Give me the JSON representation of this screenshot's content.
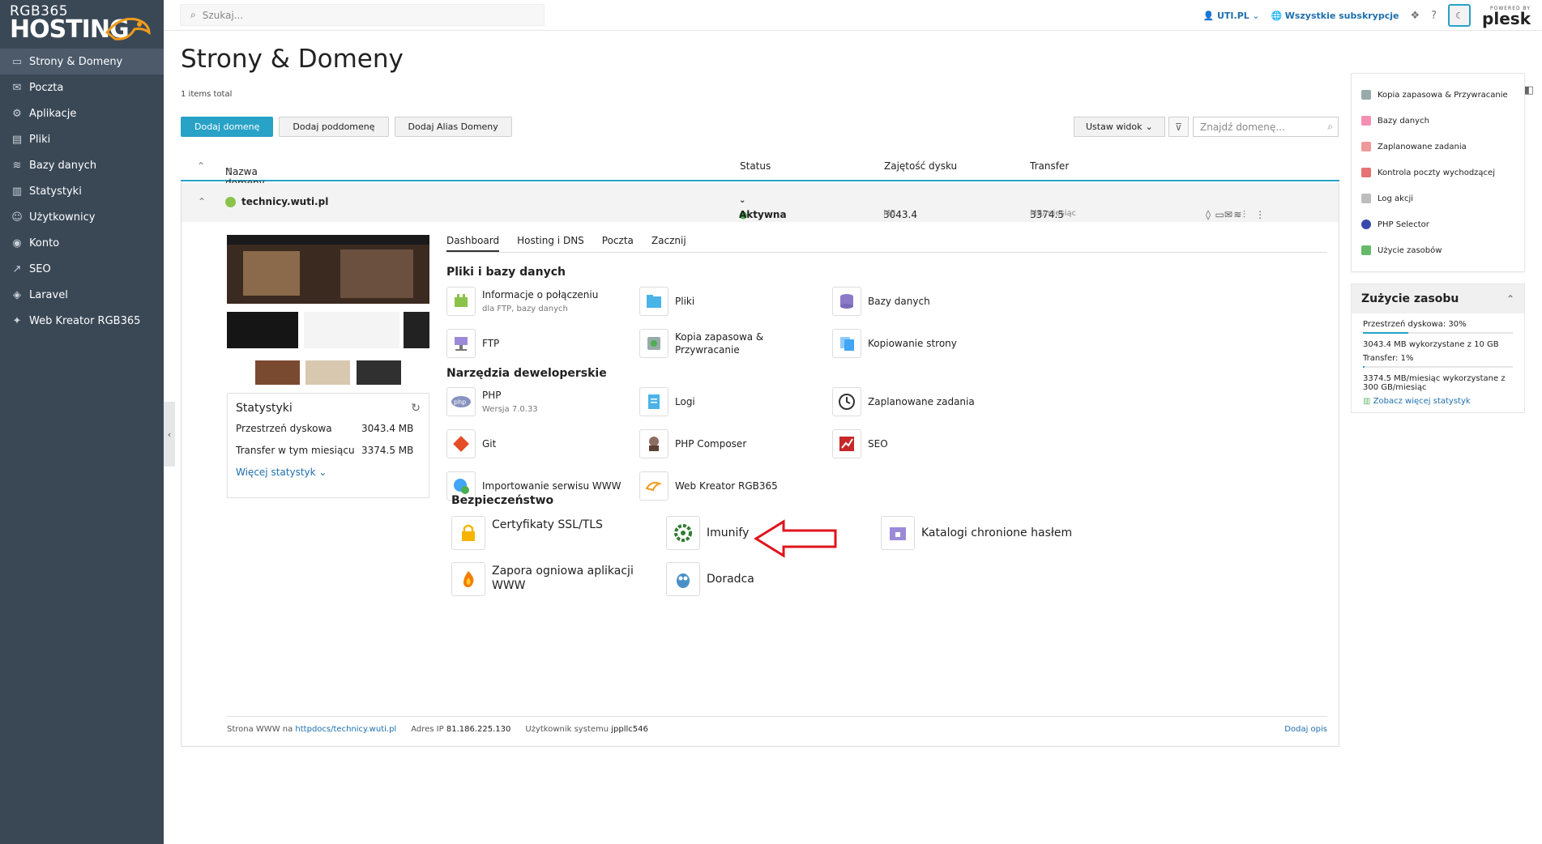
{
  "brand": {
    "line1": "RGB365",
    "line2": "HOSTING"
  },
  "sidebar": {
    "items": [
      {
        "label": "Strony & Domeny",
        "icon": "monitor-icon",
        "active": true
      },
      {
        "label": "Poczta",
        "icon": "mail-icon"
      },
      {
        "label": "Aplikacje",
        "icon": "gear-icon"
      },
      {
        "label": "Pliki",
        "icon": "folder-icon"
      },
      {
        "label": "Bazy danych",
        "icon": "database-icon"
      },
      {
        "label": "Statystyki",
        "icon": "chart-icon"
      },
      {
        "label": "Użytkownicy",
        "icon": "users-icon"
      },
      {
        "label": "Konto",
        "icon": "account-icon"
      },
      {
        "label": "SEO",
        "icon": "seo-icon"
      },
      {
        "label": "Laravel",
        "icon": "laravel-icon"
      },
      {
        "label": "Web Kreator RGB365",
        "icon": "kreator-icon"
      }
    ]
  },
  "topbar": {
    "search_placeholder": "Szukaj...",
    "account": "UTI.PL",
    "subscriptions": "Wszystkie subskrypcje",
    "plesk_small": "POWERED BY",
    "plesk_big": "plesk"
  },
  "page": {
    "title": "Strony & Domeny",
    "total": "1 items total"
  },
  "buttons": {
    "add_domain": "Dodaj domenę",
    "add_subdomain": "Dodaj poddomenę",
    "add_alias": "Dodaj Alias Domeny",
    "view": "Ustaw widok",
    "find_placeholder": "Znajdź domenę..."
  },
  "table": {
    "col_name": "Nazwa domeny",
    "col_status": "Status",
    "col_disk": "Zajętość dysku",
    "col_transfer": "Transfer"
  },
  "domain": {
    "name": "technicy.wuti.pl",
    "status": "Aktywna",
    "disk": "3043.4",
    "disk_unit": "MB",
    "transfer": "3374.5",
    "transfer_unit": "MB/miesiąc"
  },
  "stats": {
    "title": "Statystyki",
    "disk_label": "Przestrzeń dyskowa",
    "disk_value": "3043.4 MB",
    "transfer_label": "Transfer w tym miesiącu",
    "transfer_value": "3374.5 MB",
    "more": "Więcej statystyk"
  },
  "tabs": [
    "Dashboard",
    "Hosting i DNS",
    "Poczta",
    "Zacznij"
  ],
  "sections": {
    "files": "Pliki i bazy danych",
    "dev": "Narzędzia deweloperskie",
    "security": "Bezpieczeństwo"
  },
  "tools": {
    "connection": {
      "label": "Informacje o połączeniu",
      "sub": "dla FTP, bazy danych"
    },
    "files": {
      "label": "Pliki"
    },
    "databases": {
      "label": "Bazy danych"
    },
    "ftp": {
      "label": "FTP"
    },
    "backup": {
      "label": "Kopia zapasowa & Przywracanie"
    },
    "copy": {
      "label": "Kopiowanie strony"
    },
    "php": {
      "label": "PHP",
      "sub": "Wersja 7.0.33"
    },
    "logs": {
      "label": "Logi"
    },
    "tasks": {
      "label": "Zaplanowane zadania"
    },
    "git": {
      "label": "Git"
    },
    "composer": {
      "label": "PHP Composer"
    },
    "seo": {
      "label": "SEO"
    },
    "import": {
      "label": "Importowanie serwisu WWW"
    },
    "kreator": {
      "label": "Web Kreator RGB365"
    },
    "ssl": {
      "label": "Certyfikaty SSL/TLS"
    },
    "imunify": {
      "label": "Imunify"
    },
    "protected": {
      "label": "Katalogi chronione hasłem"
    },
    "firewall": {
      "label": "Zapora ogniowa aplikacji WWW"
    },
    "advisor": {
      "label": "Doradca"
    }
  },
  "footer": {
    "site_label": "Strona WWW na",
    "site_link": "httpdocs/technicy.wuti.pl",
    "ip_label": "Adres IP",
    "ip": "81.186.225.130",
    "user_label": "Użytkownik systemu",
    "user": "jppllc546",
    "add_desc": "Dodaj opis"
  },
  "right": {
    "items": [
      "Kopia zapasowa & Przywracanie",
      "Bazy danych",
      "Zaplanowane zadania",
      "Kontrola poczty wychodzącej",
      "Log akcji",
      "PHP Selector",
      "Użycie zasobów"
    ],
    "usage_title": "Zużycie zasobu",
    "disk_label": "Przestrzeń dyskowa: 30%",
    "disk_detail": "3043.4 MB wykorzystane z 10 GB",
    "transfer_label": "Transfer: 1%",
    "transfer_detail": "3374.5 MB/miesiąc wykorzystane z 300 GB/miesiąc",
    "more": "Zobacz więcej statystyk",
    "disk_pct": 30,
    "transfer_pct": 1
  },
  "colors": {
    "accent": "#28a2c7",
    "sidebar": "#3a4856",
    "link": "#1e6fad",
    "arrow": "#e0141e"
  }
}
